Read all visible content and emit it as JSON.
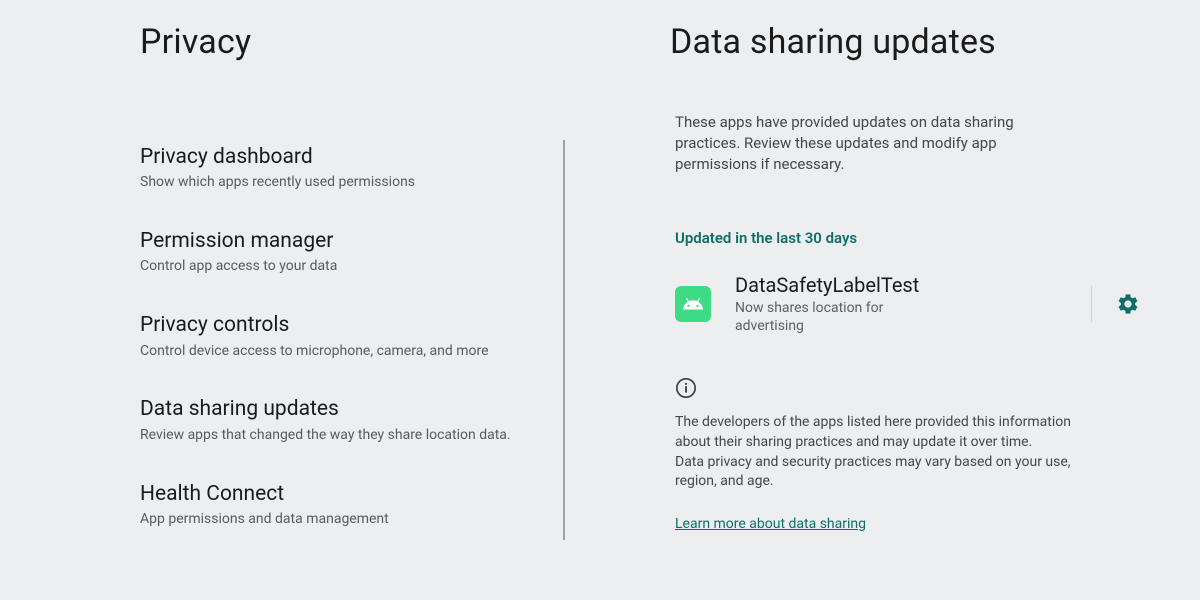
{
  "left": {
    "title": "Privacy",
    "items": [
      {
        "title": "Privacy dashboard",
        "sub": "Show which apps recently used permissions"
      },
      {
        "title": "Permission manager",
        "sub": "Control app access to your data"
      },
      {
        "title": "Privacy controls",
        "sub": "Control device access to microphone, camera, and more"
      },
      {
        "title": "Data sharing updates",
        "sub": "Review apps that changed the way they share location data."
      },
      {
        "title": "Health Connect",
        "sub": "App permissions and data management"
      }
    ]
  },
  "right": {
    "title": "Data sharing updates",
    "intro": "These apps have provided updates on data sharing practices. Review these updates and modify app permissions if necessary.",
    "section_heading": "Updated in the last 30 days",
    "app": {
      "name": "DataSafetyLabelTest",
      "sub": "Now shares location for advertising"
    },
    "info1": "The developers of the apps listed here provided this information about their sharing practices and may update it over time.",
    "info2": "Data privacy and security practices may vary based on your use, region, and age.",
    "learn_more": "Learn more about data sharing"
  },
  "colors": {
    "accent": "#0f6e68",
    "android_green": "#3ddc84"
  }
}
